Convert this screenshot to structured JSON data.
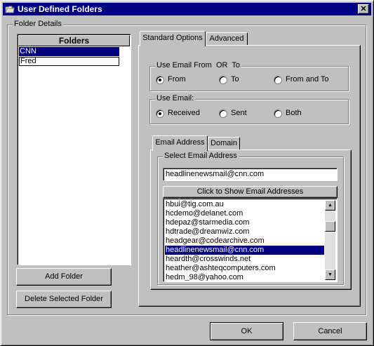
{
  "window": {
    "title": "User Defined Folders",
    "close_glyph": "✕"
  },
  "folder_details": {
    "group_label": "Folder Details",
    "list_header": "Folders",
    "folders": [
      "CNN",
      "Fred"
    ],
    "selected_index": 0,
    "add_button": "Add Folder",
    "delete_button": "Delete Selected Folder"
  },
  "tabs": [
    {
      "label": "Standard Options",
      "active": true
    },
    {
      "label": "Advanced",
      "active": false
    }
  ],
  "use_email_from_to": {
    "group_label": "Use Email From  OR  To",
    "options": [
      "From",
      "To",
      "From and To"
    ],
    "selected": "From"
  },
  "use_email": {
    "group_label": "Use Email:",
    "options": [
      "Received",
      "Sent",
      "Both"
    ],
    "selected": "Received"
  },
  "subtabs": [
    {
      "label": "Email Address",
      "active": true
    },
    {
      "label": "Domain",
      "active": false
    }
  ],
  "select_email": {
    "group_label": "Select Email Address",
    "input_value": "headlinenewsmail@cnn.com",
    "show_button": "Click to Show Email Addresses",
    "addresses": [
      "hbui@tig.com.au",
      "hcdemo@delanet.com",
      "hdepaz@starmedia.com",
      "hdtrade@dreamwiz.com",
      "headgear@codearchive.com",
      "headlinenewsmail@cnn.com",
      "heardth@crosswinds.net",
      "heather@ashteqcomputers.com",
      "hedm_98@yahoo.com"
    ],
    "selected_index": 5
  },
  "footer": {
    "ok_button": "OK",
    "cancel_button": "Cancel"
  }
}
